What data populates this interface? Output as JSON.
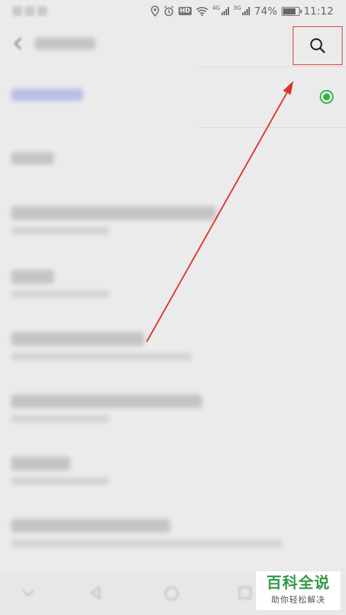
{
  "status_bar": {
    "battery_percent": "74%",
    "time": "11:12",
    "network_1": "4G",
    "network_2": "3G",
    "hd_badge": "HD",
    "battery_level": 0.74
  },
  "header": {
    "back_icon": "chevron-left-icon",
    "title": "",
    "search_icon": "search-icon"
  },
  "list": {
    "items": [
      {
        "title": "",
        "subtitle": "",
        "selected": true
      },
      {
        "title": "",
        "subtitle": ""
      },
      {
        "title": "",
        "subtitle": ""
      },
      {
        "title": "",
        "subtitle": ""
      },
      {
        "title": "",
        "subtitle": ""
      },
      {
        "title": "",
        "subtitle": ""
      },
      {
        "title": "",
        "subtitle": ""
      },
      {
        "title": "",
        "subtitle": ""
      }
    ]
  },
  "annotation": {
    "highlight_color": "#d8342c",
    "arrow_color": "#e0302a"
  },
  "watermark": {
    "main": "百科全说",
    "sub": "助你轻松解决",
    "color": "#2e9a45"
  }
}
